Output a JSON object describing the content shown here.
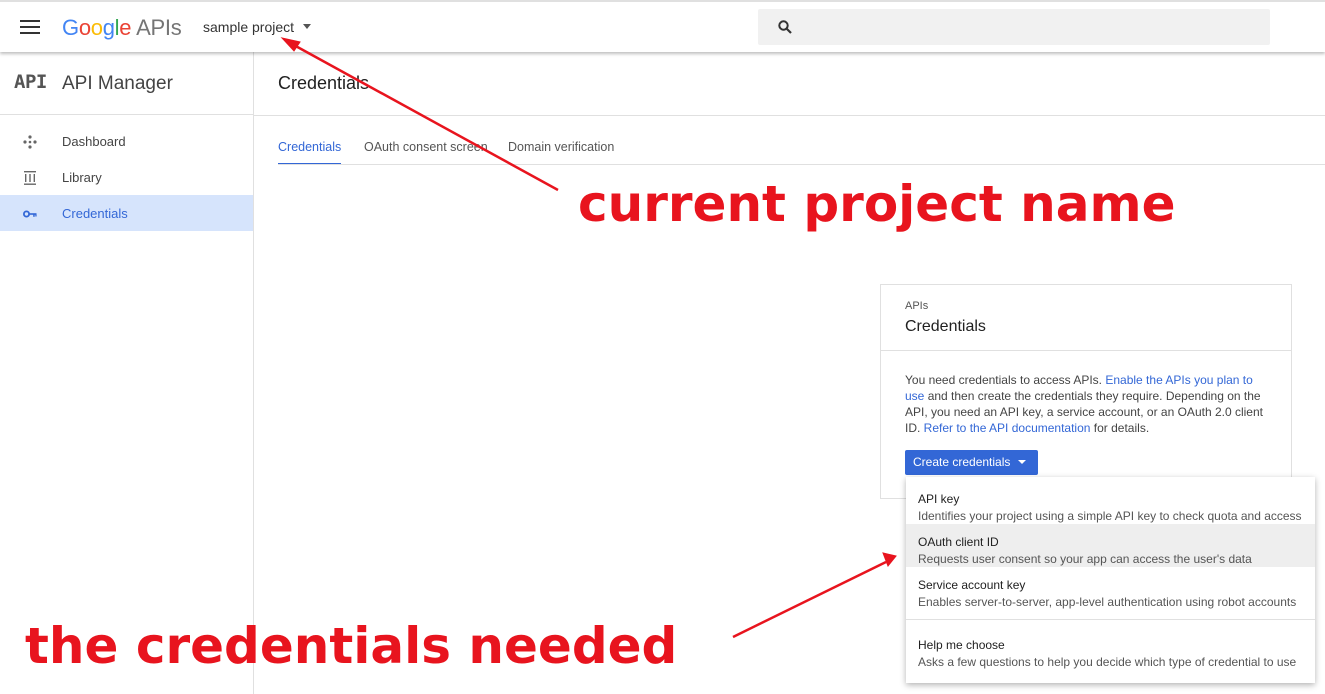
{
  "topbar": {
    "logo": {
      "letters": [
        "G",
        "o",
        "o",
        "g",
        "l",
        "e"
      ],
      "suffix": "APIs"
    },
    "project_name": "sample project"
  },
  "sidebar": {
    "logo_text": "API",
    "title": "API Manager",
    "items": [
      {
        "label": "Dashboard",
        "icon": "dashboard-icon"
      },
      {
        "label": "Library",
        "icon": "library-icon"
      },
      {
        "label": "Credentials",
        "icon": "key-icon",
        "active": true
      }
    ]
  },
  "main": {
    "title": "Credentials",
    "tabs": [
      {
        "label": "Credentials",
        "active": true
      },
      {
        "label": "OAuth consent screen"
      },
      {
        "label": "Domain verification"
      }
    ]
  },
  "card": {
    "kicker": "APIs",
    "title": "Credentials",
    "body_1": "You need credentials to access APIs. ",
    "link_1": "Enable the APIs you plan to use",
    "body_2": " and then create the credentials they require. Depending on the API, you need an API key, a service account, or an OAuth 2.0 client ID. ",
    "link_2": "Refer to the API documentation",
    "body_3": " for details.",
    "button_label": "Create credentials"
  },
  "dropdown": {
    "items": [
      {
        "title": "API key",
        "desc": "Identifies your project using a simple API key to check quota and access"
      },
      {
        "title": "OAuth client ID",
        "desc": "Requests user consent so your app can access the user's data"
      },
      {
        "title": "Service account key",
        "desc": "Enables server-to-server, app-level authentication using robot accounts"
      },
      {
        "title": "Help me choose",
        "desc": "Asks a few questions to help you decide which type of credential to use"
      }
    ]
  },
  "annotations": {
    "project": "current project name",
    "credentials": "the credentials needed",
    "color": "#e8141e"
  },
  "colors": {
    "accent": "#3367d6",
    "active_bg": "#d6e4fc"
  }
}
